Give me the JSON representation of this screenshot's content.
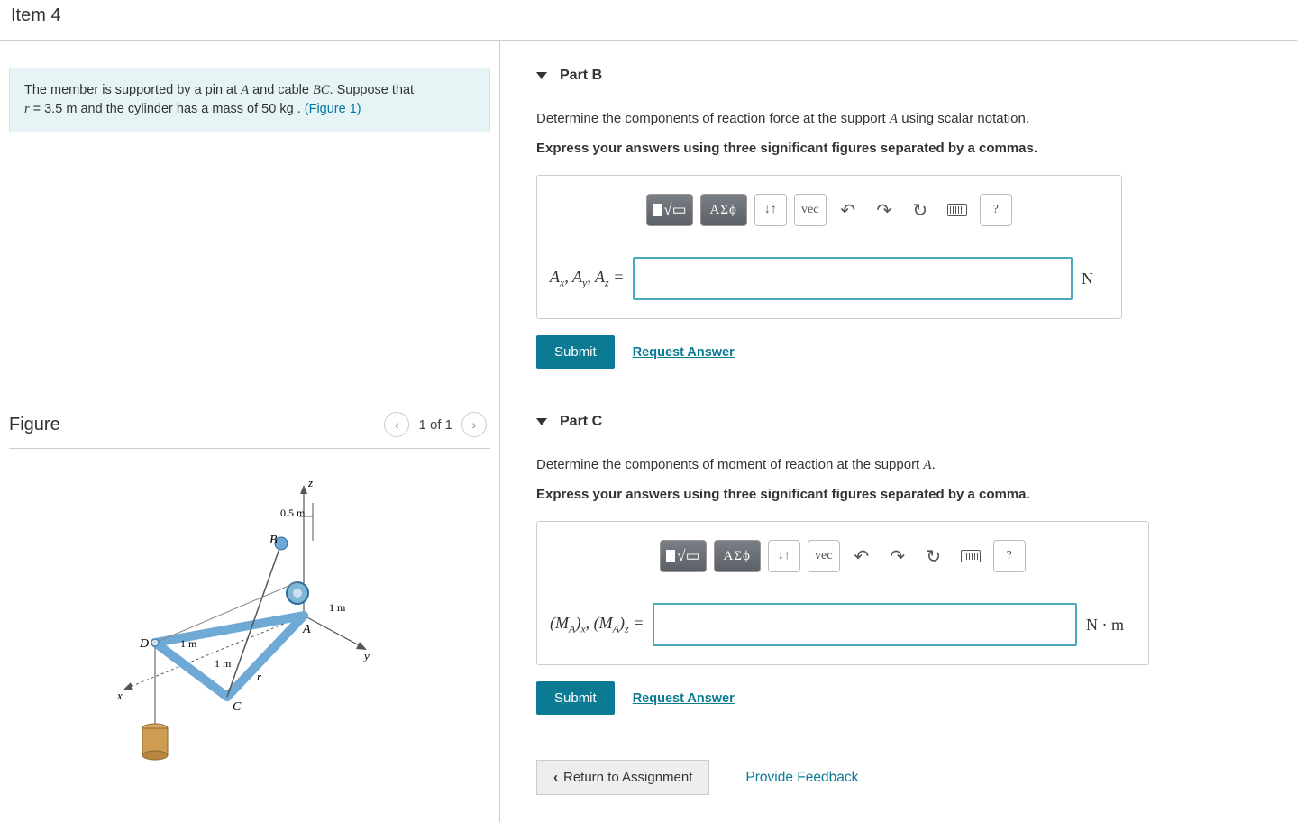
{
  "header": {
    "item_title": "Item 4"
  },
  "prompt": {
    "line1a": "The member is supported by a pin at ",
    "pointA": "A",
    "line1b": " and cable ",
    "cableBC": "BC",
    "line1c": ". Suppose that ",
    "var_r": "r",
    "rval": " = 3.5  m",
    "line2a": " and the cylinder has a mass of 50  ",
    "kg": "kg",
    "dot": " . ",
    "figlink": "(Figure 1)"
  },
  "figure": {
    "title": "Figure",
    "counter": "1 of 1",
    "labels": {
      "z": "z",
      "x": "x",
      "y": "y",
      "A": "A",
      "B": "B",
      "C": "C",
      "D": "D",
      "r": "r",
      "d05": "0.5 m",
      "d1a": "1 m",
      "d1b": "1 m",
      "d1c": "1 m"
    }
  },
  "partB": {
    "title": "Part B",
    "instruction_a": "Determine the components of reaction force at the support ",
    "pointA": "A",
    "instruction_b": " using scalar notation.",
    "instruction2": "Express your answers using three significant figures separated by a commas.",
    "eq_label_html": "A_x, A_y, A_z =",
    "unit": "N",
    "submit": "Submit",
    "request": "Request Answer",
    "toolbar": {
      "templates": "▮√▭",
      "greek": "ΑΣϕ",
      "subsup": "↓↑",
      "vec": "vec",
      "undo": "↶",
      "redo": "↷",
      "reset": "↻",
      "keyboard": "kbd",
      "help": "?"
    }
  },
  "partC": {
    "title": "Part C",
    "instruction_a": "Determine the components of moment of reaction at the support ",
    "pointA": "A",
    "instruction_b": ".",
    "instruction2": "Express your answers using three significant figures separated by a comma.",
    "eq_label_html": "(M_A)_x, (M_A)_z =",
    "unit": "N · m",
    "submit": "Submit",
    "request": "Request Answer"
  },
  "footer": {
    "return": "Return to Assignment",
    "feedback": "Provide Feedback"
  }
}
